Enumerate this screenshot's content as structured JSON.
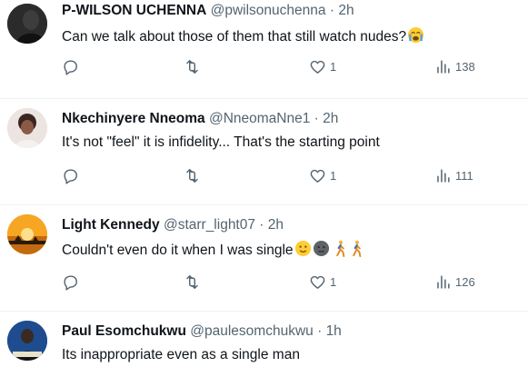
{
  "tweets": [
    {
      "name": "P-WILSON UCHENNA",
      "handle": "@pwilsonuchenna",
      "separator": "·",
      "time": "2h",
      "text": "Can we talk about those of them that still watch nudes?",
      "emojis": [
        "crying-face"
      ],
      "replies": "",
      "retweets": "",
      "likes": "1",
      "views": "138",
      "avatar_colors": [
        "#1b1b1b",
        "#4a4a4a"
      ]
    },
    {
      "name": "Nkechinyere Nneoma",
      "handle": "@NneomaNne1",
      "separator": "·",
      "time": "2h",
      "text": "It's not \"feel\" it is infidelity... That's the starting point",
      "emojis": [],
      "replies": "",
      "retweets": "",
      "likes": "1",
      "views": "111",
      "avatar_colors": [
        "#e8d7cf",
        "#5a3a2e"
      ]
    },
    {
      "name": "Light Kennedy",
      "handle": "@starr_light07",
      "separator": "·",
      "time": "2h",
      "text": "Couldn't even do it when I was single",
      "emojis": [
        "slightly-smiling-face",
        "neutral-face",
        "person-walking",
        "person-walking"
      ],
      "replies": "",
      "retweets": "",
      "likes": "1",
      "views": "126",
      "avatar_colors": [
        "#f4a21a",
        "#2a1a08"
      ]
    },
    {
      "name": "Paul Esomchukwu",
      "handle": "@paulesomchukwu",
      "separator": "·",
      "time": "1h",
      "text": "Its inappropriate even as a single man",
      "emojis": [],
      "avatar_colors": [
        "#1e4c8f",
        "#1a1a1a"
      ]
    }
  ],
  "colors": {
    "text": "#0f1419",
    "secondary": "#536471",
    "divider": "#eff3f4"
  }
}
